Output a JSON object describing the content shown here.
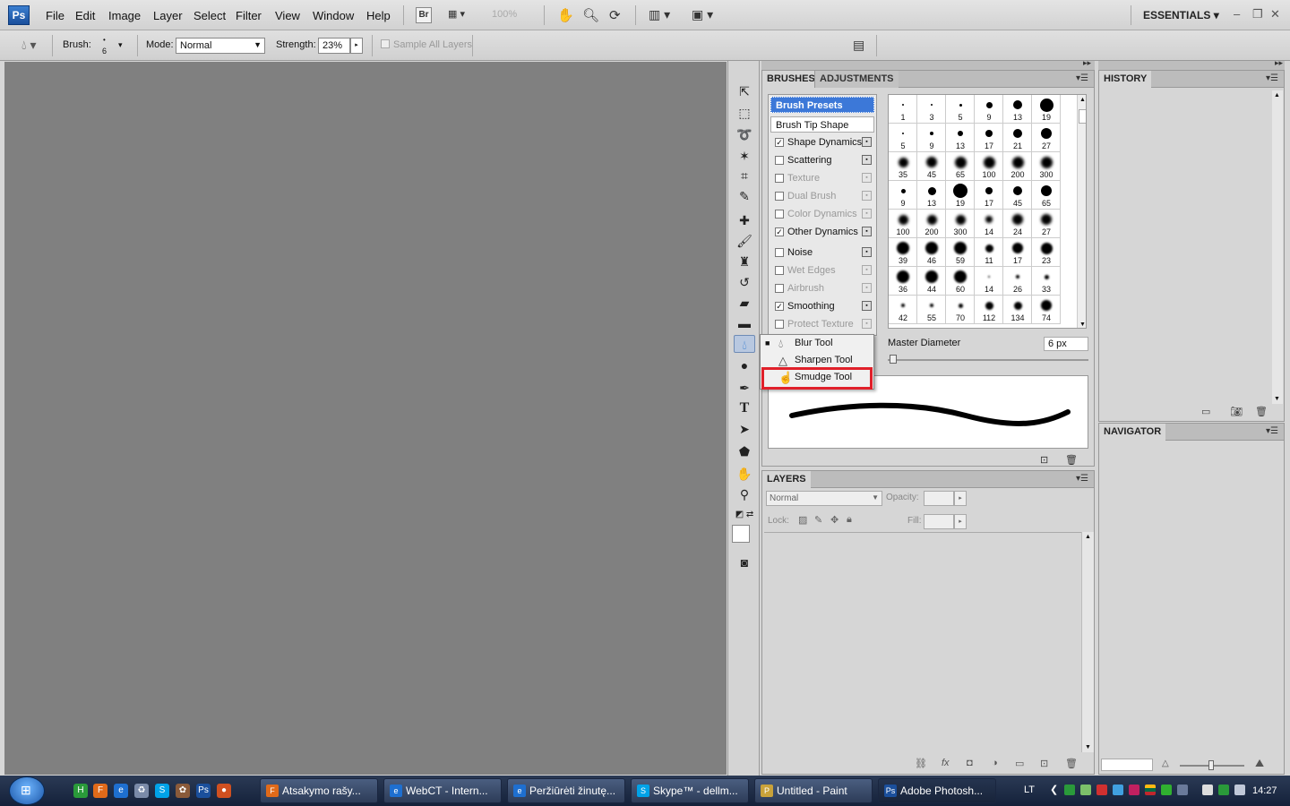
{
  "menubar": {
    "logo": "Ps",
    "items": [
      "File",
      "Edit",
      "Image",
      "Layer",
      "Select",
      "Filter",
      "View",
      "Window",
      "Help"
    ],
    "bridge": "Br",
    "zoom": "100%",
    "workspace": "ESSENTIALS"
  },
  "options": {
    "brush_label": "Brush:",
    "brush_size": "6",
    "mode_label": "Mode:",
    "mode_value": "Normal",
    "strength_label": "Strength:",
    "strength_value": "23%",
    "sample_all_layers": "Sample All Layers"
  },
  "brushes_panel": {
    "tabs": [
      "BRUSHES",
      "ADJUSTMENTS"
    ],
    "list": [
      {
        "label": "Brush Presets",
        "type": "selected"
      },
      {
        "label": "Brush Tip Shape",
        "type": "header"
      },
      {
        "label": "Shape Dynamics",
        "checked": "✓",
        "type": "normal"
      },
      {
        "label": "Scattering",
        "checked": "",
        "type": "normal"
      },
      {
        "label": "Texture",
        "checked": "",
        "type": "disabled"
      },
      {
        "label": "Dual Brush",
        "checked": "",
        "type": "disabled"
      },
      {
        "label": "Color Dynamics",
        "checked": "",
        "type": "disabled"
      },
      {
        "label": "Other Dynamics",
        "checked": "✓",
        "type": "normal"
      },
      {
        "label": "Noise",
        "checked": "",
        "type": "normal"
      },
      {
        "label": "Wet Edges",
        "checked": "",
        "type": "disabled"
      },
      {
        "label": "Airbrush",
        "checked": "",
        "type": "disabled"
      },
      {
        "label": "Smoothing",
        "checked": "✓",
        "type": "normal"
      },
      {
        "label": "Protect Texture",
        "checked": "",
        "type": "disabled"
      }
    ],
    "grid_numbers": [
      [
        "1",
        "3",
        "5",
        "9",
        "13",
        "19"
      ],
      [
        "5",
        "9",
        "13",
        "17",
        "21",
        "27"
      ],
      [
        "35",
        "45",
        "65",
        "100",
        "200",
        "300"
      ],
      [
        "9",
        "13",
        "19",
        "17",
        "45",
        "65"
      ],
      [
        "100",
        "200",
        "300",
        "14",
        "24",
        "27"
      ],
      [
        "39",
        "46",
        "59",
        "11",
        "17",
        "23"
      ],
      [
        "36",
        "44",
        "60",
        "14",
        "26",
        "33"
      ],
      [
        "42",
        "55",
        "70",
        "112",
        "134",
        "74"
      ]
    ],
    "master_diameter_label": "Master Diameter",
    "master_diameter_value": "6 px"
  },
  "flyout": {
    "items": [
      "Blur Tool",
      "Sharpen Tool",
      "Smudge Tool"
    ]
  },
  "history_panel": {
    "title": "HISTORY"
  },
  "navigator_panel": {
    "title": "NAVIGATOR"
  },
  "layers_panel": {
    "title": "LAYERS",
    "blend_mode": "Normal",
    "opacity_label": "Opacity:",
    "lock_label": "Lock:",
    "fill_label": "Fill:"
  },
  "taskbar": {
    "tasks": [
      {
        "label": "Atsakymo rašy...",
        "color": "#e06a1a",
        "icon": "F"
      },
      {
        "label": "WebCT - Intern...",
        "color": "#1e6fd0",
        "icon": "e"
      },
      {
        "label": "Peržiūrėti žinutę...",
        "color": "#1e6fd0",
        "icon": "e"
      },
      {
        "label": "Skype™ - dellm...",
        "color": "#00a2e8",
        "icon": "S"
      },
      {
        "label": "Untitled - Paint",
        "color": "#c9a23a",
        "icon": "P"
      },
      {
        "label": "Adobe Photosh...",
        "color": "#1a4f9c",
        "icon": "Ps"
      }
    ],
    "lang": "LT",
    "clock": "14:27"
  }
}
